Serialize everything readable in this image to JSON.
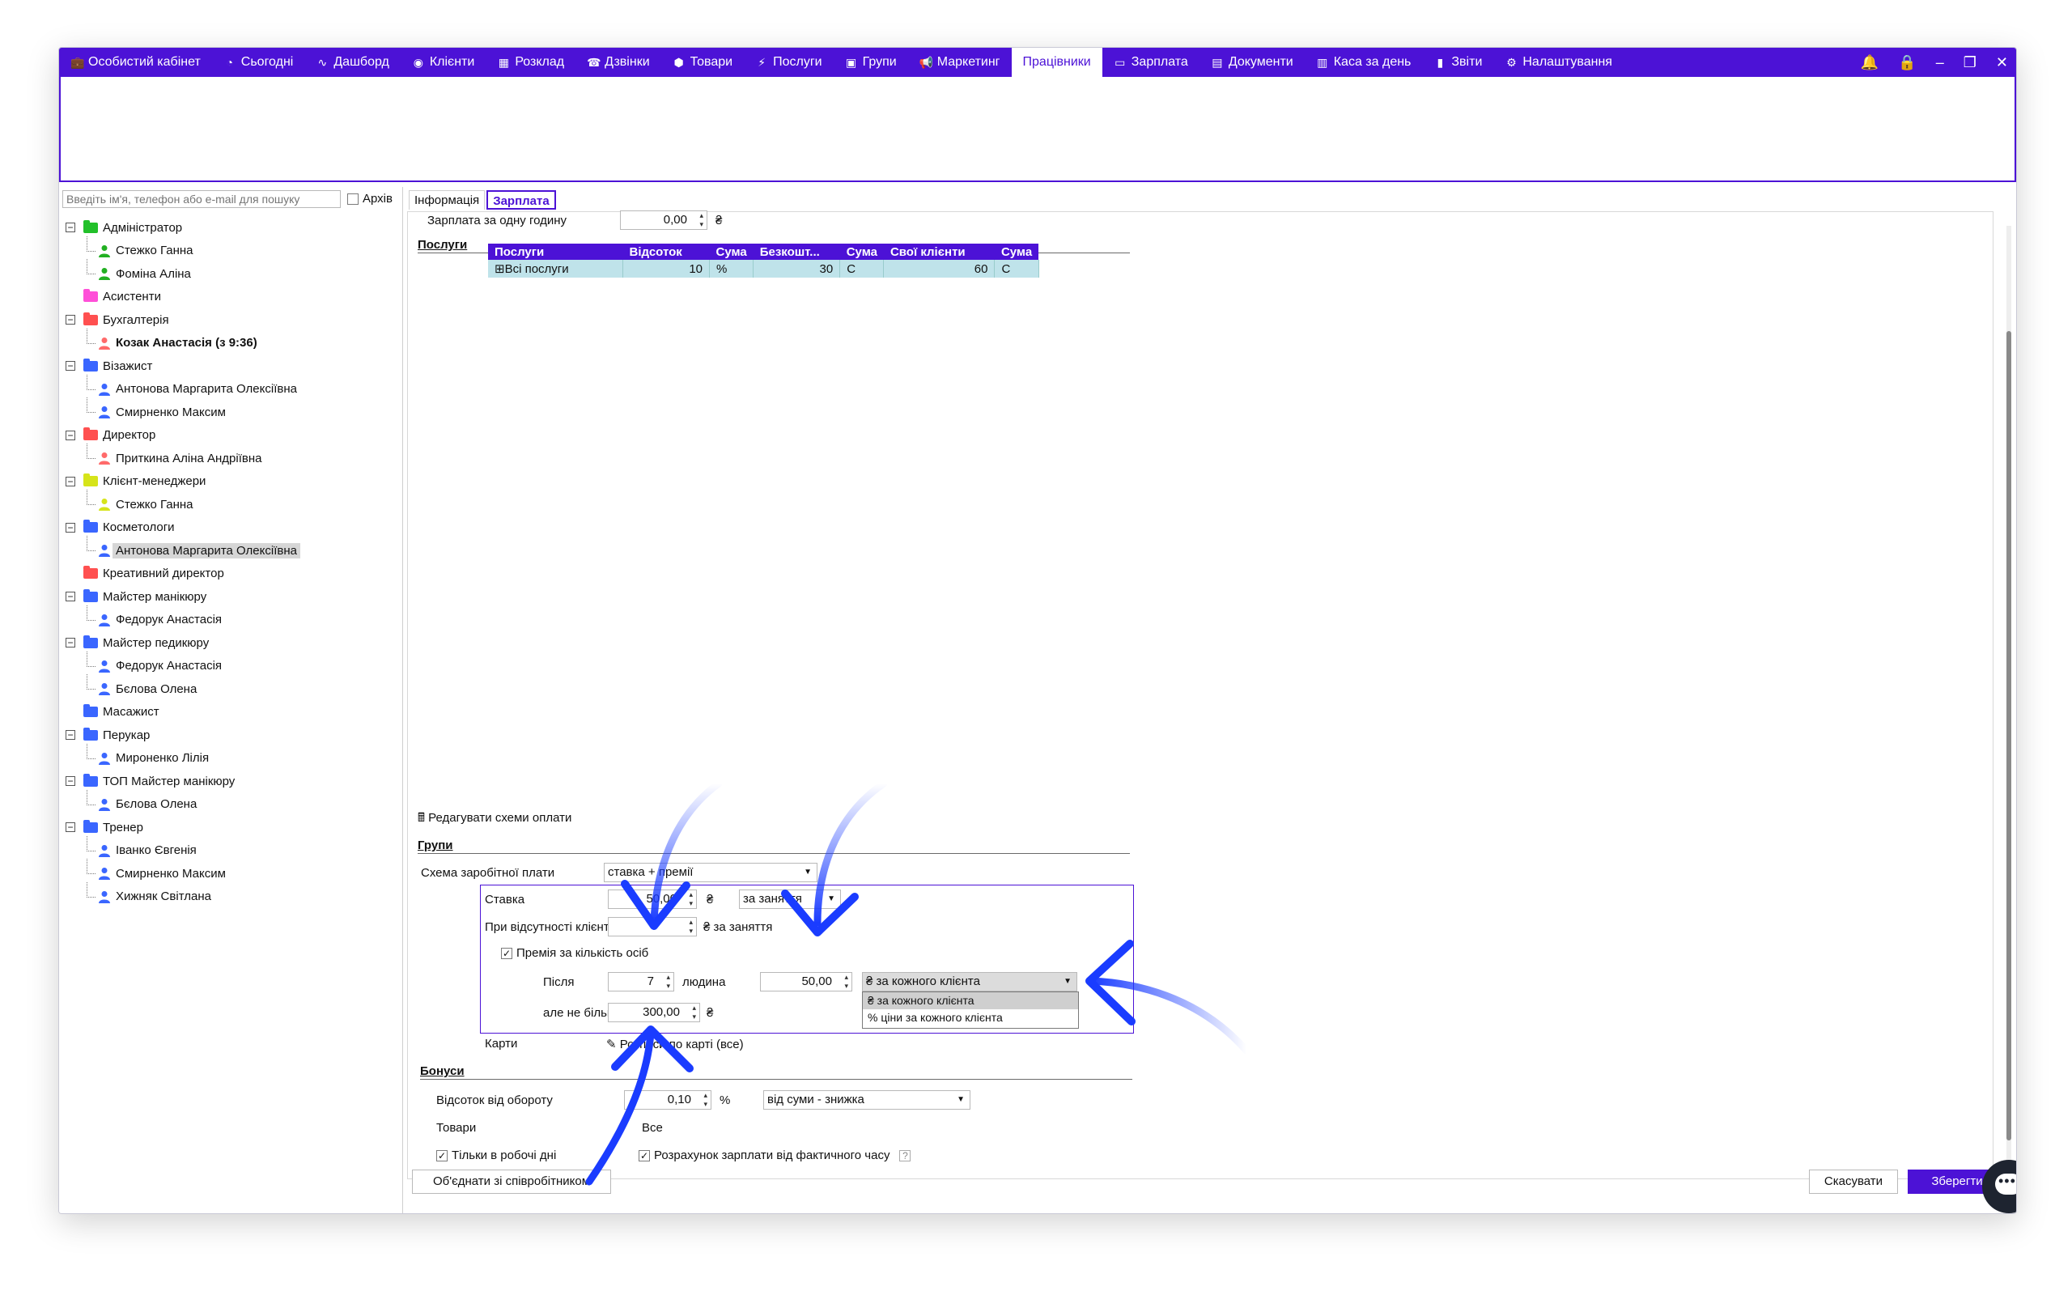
{
  "nav": {
    "items": [
      {
        "label": "Особистий кабінет",
        "icon": "briefcase-icon"
      },
      {
        "label": "Сьогодні",
        "icon": "clock-icon"
      },
      {
        "label": "Дашборд",
        "icon": "pulse-icon"
      },
      {
        "label": "Клієнти",
        "icon": "user-circle-icon"
      },
      {
        "label": "Розклад",
        "icon": "calendar-icon"
      },
      {
        "label": "Дзвінки",
        "icon": "phone-icon"
      },
      {
        "label": "Товари",
        "icon": "box-icon"
      },
      {
        "label": "Послуги",
        "icon": "bolt-icon"
      },
      {
        "label": "Групи",
        "icon": "group-icon"
      },
      {
        "label": "Маркетинг",
        "icon": "megaphone-icon"
      },
      {
        "label": "Працівники",
        "icon": "",
        "active": true
      },
      {
        "label": "Зарплата",
        "icon": "money-icon"
      },
      {
        "label": "Документи",
        "icon": "document-icon"
      },
      {
        "label": "Каса за день",
        "icon": "calculator-icon"
      },
      {
        "label": "Звіти",
        "icon": "bar-chart-icon"
      },
      {
        "label": "Налаштування",
        "icon": "gear-icon"
      }
    ],
    "window_controls": [
      "bell-icon",
      "lock-icon",
      "minimize-icon",
      "restore-icon",
      "close-icon"
    ]
  },
  "left": {
    "search_placeholder": "Введіть ім'я, телефон або e-mail для пошуку",
    "archive_label": "Архів",
    "tree": [
      {
        "type": "group",
        "label": "Адміністратор",
        "color": "#22c02a",
        "expanded": true
      },
      {
        "type": "person",
        "label": "Стежко Ганна",
        "color": "#22b022"
      },
      {
        "type": "person",
        "label": "Фоміна Аліна",
        "color": "#22b022"
      },
      {
        "type": "group",
        "label": "Асистенти",
        "color": "#ff4fd8",
        "expanded": null
      },
      {
        "type": "group",
        "label": "Бухгалтерія",
        "color": "#ff5050",
        "expanded": true
      },
      {
        "type": "person",
        "label": "Козак Анастасія (з 9:36)",
        "color": "#ff6a6a",
        "bold": true
      },
      {
        "type": "group",
        "label": "Візажист",
        "color": "#3a66ff",
        "expanded": true
      },
      {
        "type": "person",
        "label": "Антонова Маргарита Олексіївна",
        "color": "#3a66ff"
      },
      {
        "type": "person",
        "label": "Смирненко Максим",
        "color": "#3a66ff"
      },
      {
        "type": "group",
        "label": "Директор",
        "color": "#ff5050",
        "expanded": true
      },
      {
        "type": "person",
        "label": "Приткина Аліна Андріївна",
        "color": "#ff6a6a"
      },
      {
        "type": "group",
        "label": "Клієнт-менеджери",
        "color": "#d6e41a",
        "expanded": true
      },
      {
        "type": "person",
        "label": "Стежко Ганна",
        "color": "#d6e41a"
      },
      {
        "type": "group",
        "label": "Косметологи",
        "color": "#3a66ff",
        "expanded": true
      },
      {
        "type": "person",
        "label": "Антонова Маргарита Олексіївна",
        "color": "#3a66ff",
        "selected": true
      },
      {
        "type": "group",
        "label": "Креативний директор",
        "color": "#ff5050",
        "expanded": null
      },
      {
        "type": "group",
        "label": "Майстер манікюру",
        "color": "#3a66ff",
        "expanded": true
      },
      {
        "type": "person",
        "label": "Федорук Анастасія",
        "color": "#3a66ff"
      },
      {
        "type": "group",
        "label": "Майстер педикюру",
        "color": "#3a66ff",
        "expanded": true
      },
      {
        "type": "person",
        "label": "Федорук Анастасія",
        "color": "#3a66ff"
      },
      {
        "type": "person",
        "label": "Бєлова Олена",
        "color": "#3a66ff"
      },
      {
        "type": "group",
        "label": "Масажист",
        "color": "#3a66ff",
        "expanded": null
      },
      {
        "type": "group",
        "label": "Перукар",
        "color": "#3a66ff",
        "expanded": true
      },
      {
        "type": "person",
        "label": "Мироненко Лілія",
        "color": "#3a66ff"
      },
      {
        "type": "group",
        "label": "ТОП Майстер манікюру",
        "color": "#3a66ff",
        "expanded": true
      },
      {
        "type": "person",
        "label": "Бєлова Олена",
        "color": "#3a66ff"
      },
      {
        "type": "group",
        "label": "Тренер",
        "color": "#3a66ff",
        "expanded": true
      },
      {
        "type": "person",
        "label": "Іванко Євгенія",
        "color": "#3a66ff"
      },
      {
        "type": "person",
        "label": "Смирненко Максим",
        "color": "#3a66ff"
      },
      {
        "type": "person",
        "label": "Хижняк Світлана",
        "color": "#3a66ff"
      }
    ]
  },
  "tabs": {
    "info": "Інформація",
    "salary": "Зарплата"
  },
  "form": {
    "hourly_label": "Зарплата за одну годину",
    "hourly_value": "0,00",
    "currency": "₴",
    "services_title": "Послуги",
    "services_table": {
      "headers": [
        "Послуги",
        "Відсоток",
        "Сума",
        "Безкошт...",
        "Сума",
        "Свої клієнти",
        "Сума"
      ],
      "row": [
        "⊞Всі послуги",
        "10",
        "%",
        "30",
        "С",
        "60",
        "С"
      ]
    },
    "edit_schemes": "Редагувати схеми оплати",
    "groups_title": "Групи",
    "scheme_label": "Схема заробітної плати",
    "scheme_value": "ставка + премії",
    "rate_label": "Ставка",
    "rate_value": "50,00",
    "rate_per": "за заняття",
    "noclients_label": "При відсутності клієнтів",
    "noclients_value": "",
    "noclients_unit": "₴ за заняття",
    "bonus_check_label": "Премія за кількість осіб",
    "after_label": "Після",
    "after_value": "7",
    "people_unit": "людина",
    "bonus_amount": "50,00",
    "bonus_mode": "₴ за кожного клієнта",
    "bonus_mode_options": [
      "₴ за кожного клієнта",
      "% ціни за кожного клієнта"
    ],
    "max_label": "але не більше",
    "max_value": "300,00",
    "cards_label": "Карти",
    "cards_value": "Розписи по карті (все)",
    "bonuses_title": "Бонуси",
    "turnover_label": "Відсоток від обороту",
    "turnover_value": "0,10",
    "turnover_unit": "%",
    "turnover_mode": "від суми - знижка",
    "goods_label": "Товари",
    "goods_value": "Все",
    "workdays_label": "Тільки в робочі дні",
    "actual_time_label": "Розрахунок зарплати від фактичного часу",
    "help": "?"
  },
  "buttons": {
    "merge": "Об'єднати зі співробітником",
    "cancel": "Скасувати",
    "save": "Зберегти"
  }
}
